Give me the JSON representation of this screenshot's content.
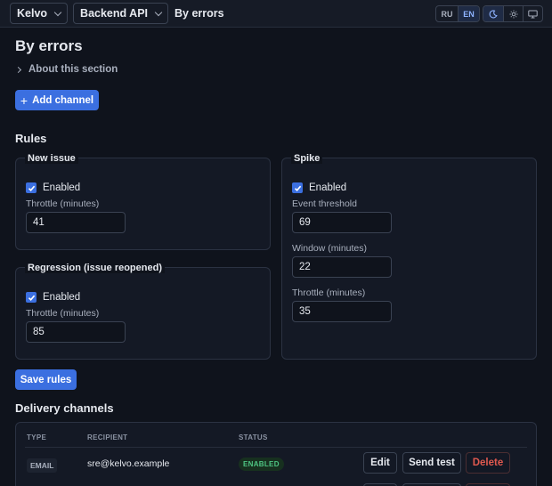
{
  "topbar": {
    "org": "Kelvo",
    "project": "Backend API",
    "current": "By errors",
    "lang": [
      "RU",
      "EN"
    ],
    "active_lang": "EN",
    "theme_icons": [
      "moon-icon",
      "sun-icon",
      "monitor-icon"
    ],
    "active_theme": "moon-icon"
  },
  "page": {
    "title": "By errors",
    "about": "About this section",
    "add_channel": "Add channel"
  },
  "rules": {
    "heading": "Rules",
    "new_issue": {
      "title": "New issue",
      "enabled_label": "Enabled",
      "enabled": true,
      "throttle_label": "Throttle (minutes)",
      "throttle": "41"
    },
    "regression": {
      "title": "Regression (issue reopened)",
      "enabled_label": "Enabled",
      "enabled": true,
      "throttle_label": "Throttle (minutes)",
      "throttle": "85"
    },
    "spike": {
      "title": "Spike",
      "enabled_label": "Enabled",
      "enabled": true,
      "threshold_label": "Event threshold",
      "threshold": "69",
      "window_label": "Window (minutes)",
      "window": "22",
      "throttle_label": "Throttle (minutes)",
      "throttle": "35"
    },
    "save": "Save rules"
  },
  "channels": {
    "heading": "Delivery channels",
    "columns": [
      "TYPE",
      "RECIPIENT",
      "STATUS"
    ],
    "rows": [
      {
        "type": "EMAIL",
        "recipient": "sre@kelvo.example",
        "status": "ENABLED",
        "edit": "Edit",
        "send_test": "Send test",
        "delete": "Delete"
      }
    ]
  },
  "colors": {
    "accent": "#3b6fe0",
    "background": "#0f131c",
    "danger": "#e0594f",
    "success": "#4ec583"
  }
}
